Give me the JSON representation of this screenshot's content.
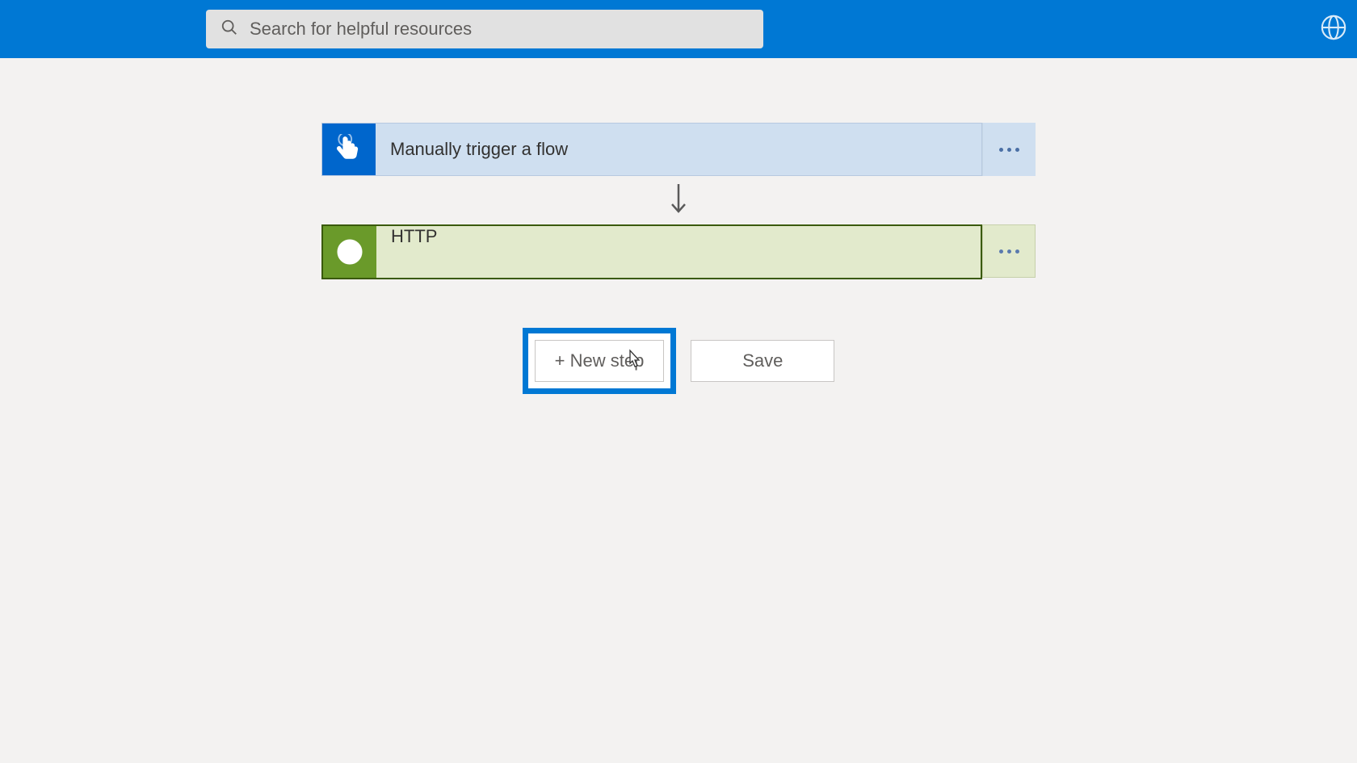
{
  "header": {
    "search_placeholder": "Search for helpful resources"
  },
  "flow": {
    "trigger": {
      "title": "Manually trigger a flow",
      "icon": "hand-pointer-icon"
    },
    "action": {
      "title": "HTTP",
      "icon": "globe-icon"
    }
  },
  "buttons": {
    "new_step": "+ New step",
    "save": "Save"
  }
}
